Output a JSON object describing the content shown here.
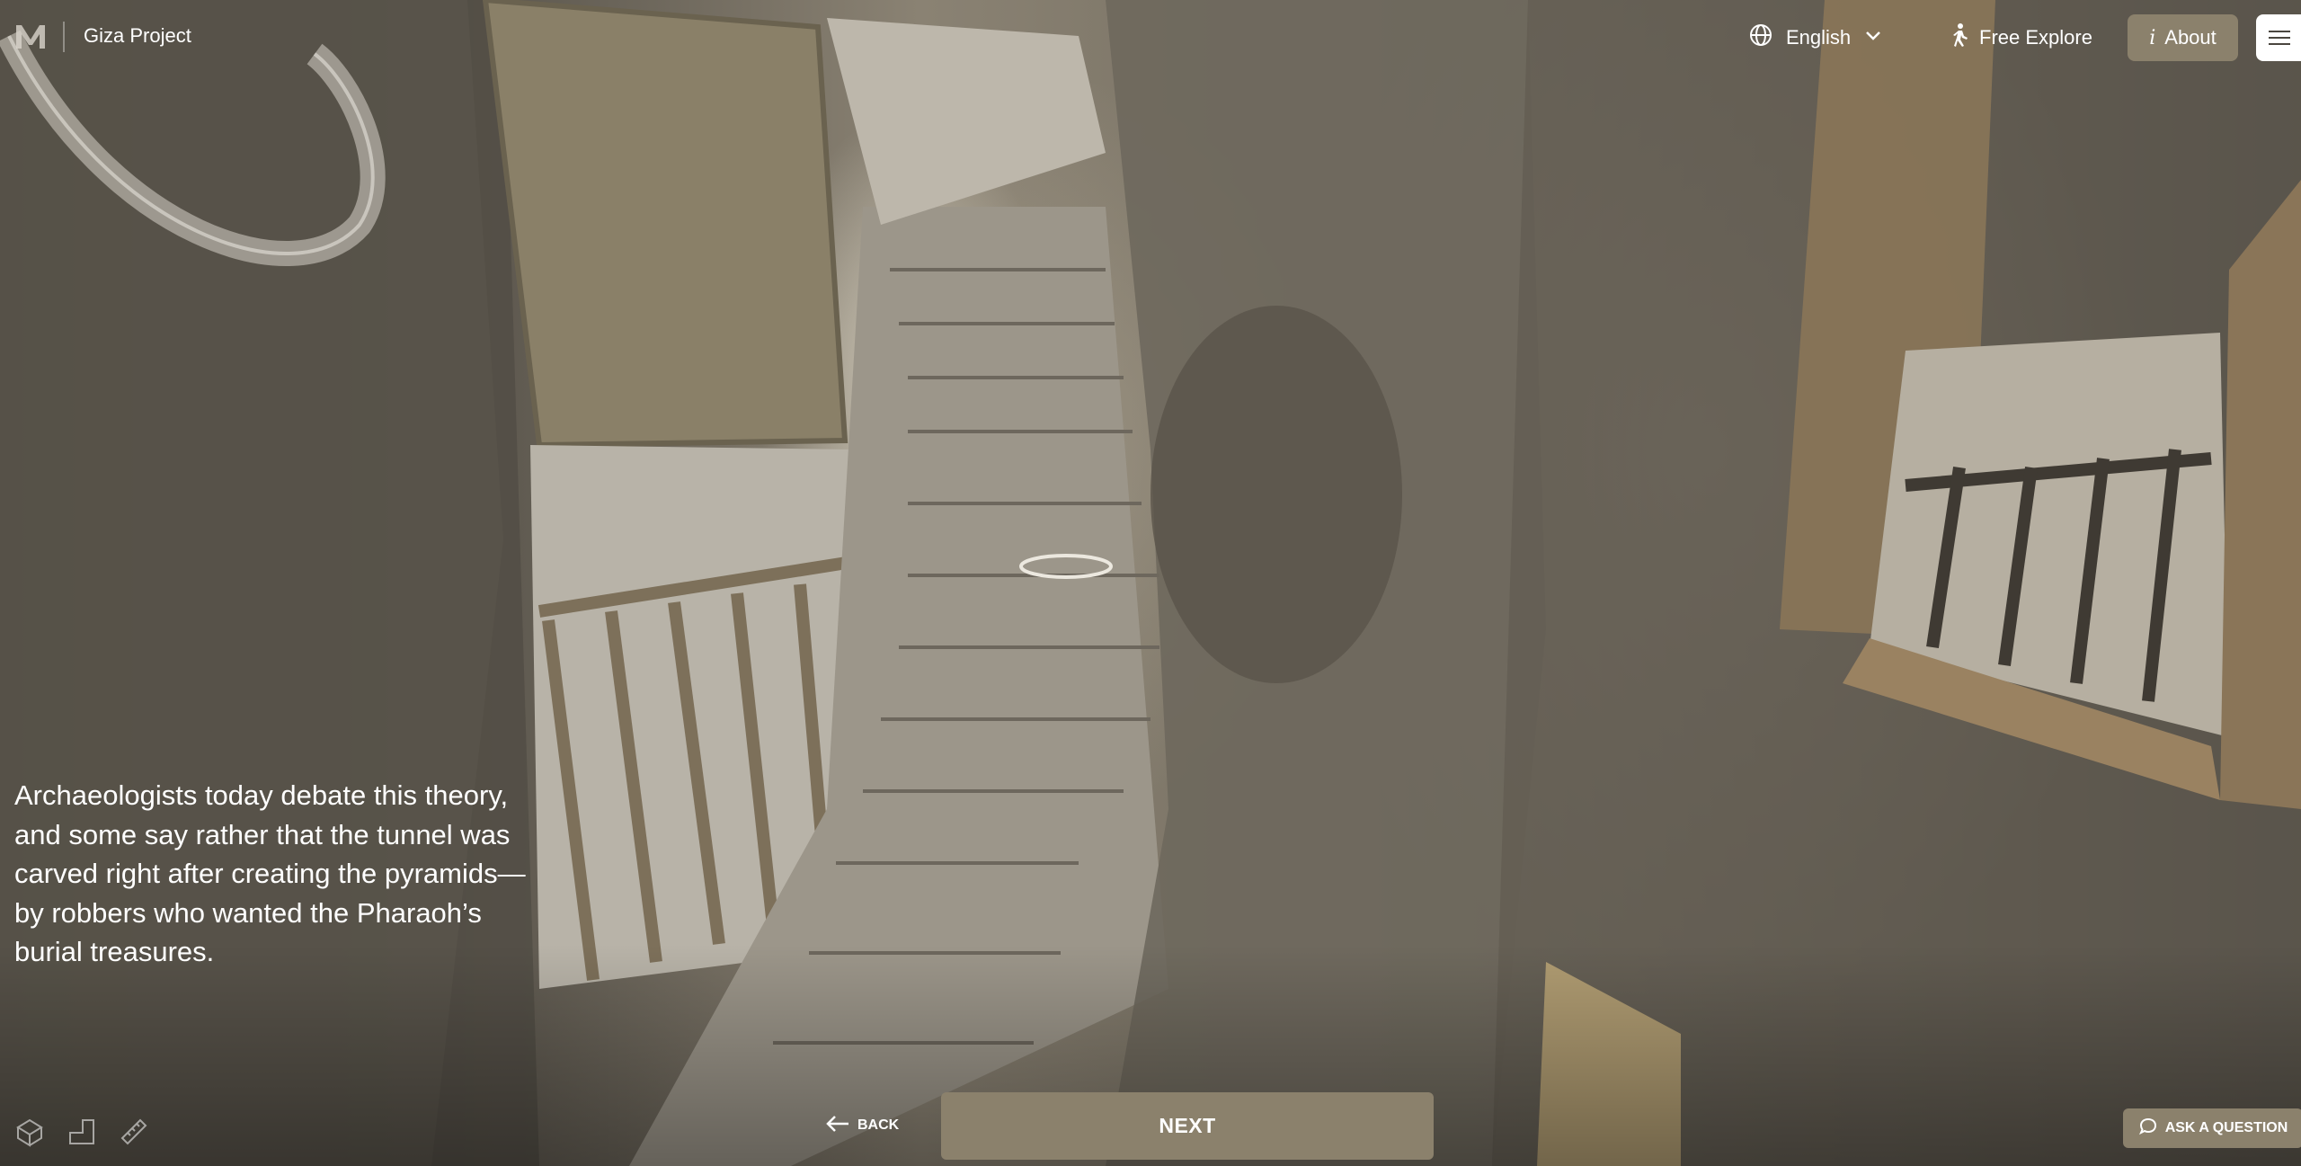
{
  "header": {
    "project_title": "Giza Project",
    "language": "English",
    "free_explore_label": "Free Explore",
    "about_label": "About"
  },
  "narration": {
    "text": "Archaeologists today debate this theory, and some say rather that the tunnel was carved right after creating the pyramids—by robbers who wanted the Pharaoh’s burial treasures."
  },
  "navigation": {
    "back_label": "BACK",
    "next_label": "NEXT",
    "ask_label": "ASK A QUESTION"
  },
  "icons": [
    "logo-m-icon",
    "globe-icon",
    "chevron-down-icon",
    "walking-person-icon",
    "info-icon",
    "menu-icon",
    "cube-icon",
    "floorplan-icon",
    "ruler-icon",
    "arrow-left-icon",
    "chat-bubble-icon"
  ],
  "colors": {
    "accent": "#8b816c",
    "text": "#ffffff"
  }
}
